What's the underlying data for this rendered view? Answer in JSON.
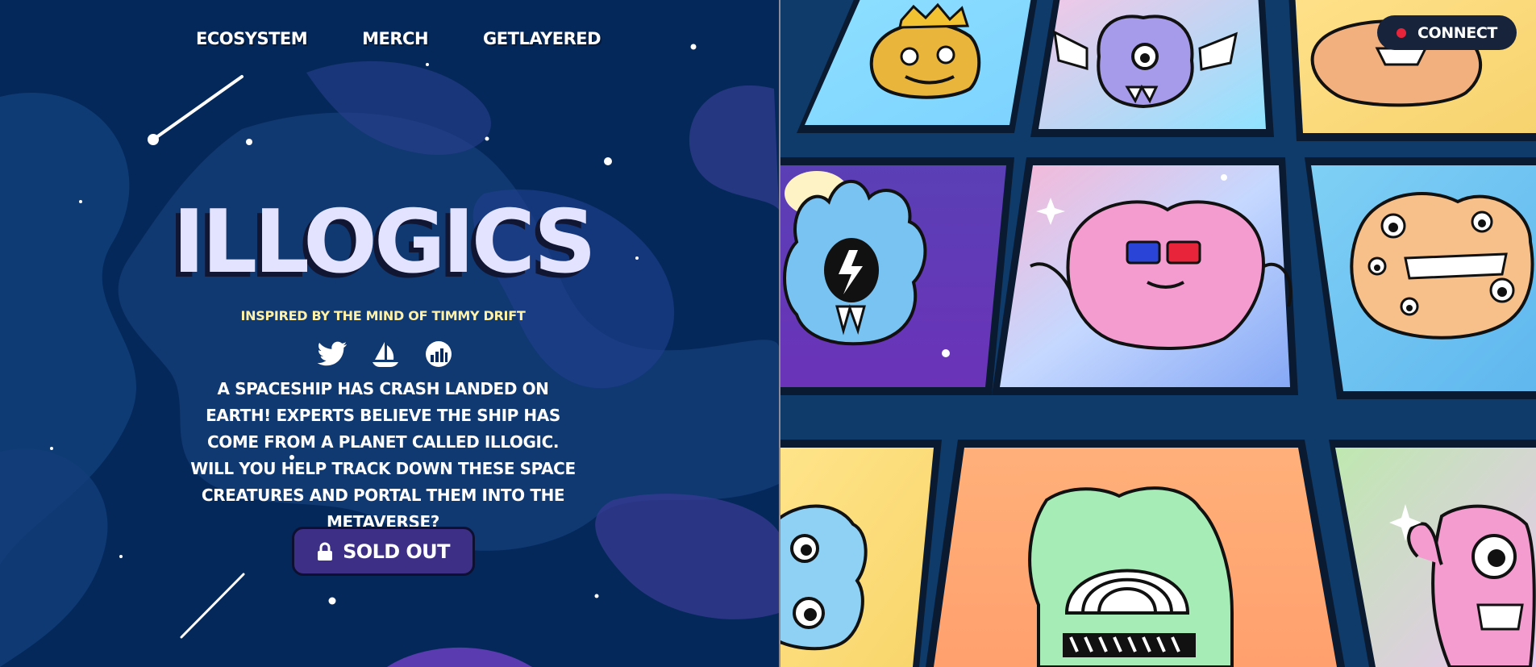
{
  "nav": {
    "items": [
      {
        "label": "ECOSYSTEM"
      },
      {
        "label": "MERCH"
      },
      {
        "label": "GETLAYERED"
      }
    ]
  },
  "hero": {
    "title": "ILLOGICS",
    "tagline": "INSPIRED BY THE MIND OF TIMMY DRIFT",
    "description": "A SPACESHIP HAS CRASH LANDED ON EARTH! EXPERTS BELIEVE THE SHIP HAS COME FROM A PLANET CALLED ILLOGIC. WILL YOU HELP TRACK DOWN THESE SPACE CREATURES AND PORTAL THEM INTO THE METAVERSE?",
    "button_label": "SOLD OUT"
  },
  "socials": [
    {
      "icon": "twitter-icon"
    },
    {
      "icon": "opensea-sailboat-icon"
    },
    {
      "icon": "rarity-chart-icon"
    }
  ],
  "header": {
    "connect_label": "CONNECT"
  },
  "colors": {
    "background": "#04285a",
    "title": "#e4e3ff",
    "tagline": "#fff2a8",
    "button": "#3e2f86",
    "connect_bg": "#17233b",
    "connect_dot": "#e8243a",
    "grid_bg": "#0f3b6b"
  },
  "gallery": {
    "cards": [
      {
        "creature": "crowned-yellow-blob"
      },
      {
        "creature": "winged-purple-fang-blob"
      },
      {
        "creature": "orange-tentacle-creature"
      },
      {
        "creature": "blue-flame-lightning-creature"
      },
      {
        "creature": "pink-creature-with-3d-glasses"
      },
      {
        "creature": "orange-many-eyed-blob"
      },
      {
        "creature": "blue-cloud-eyes-creature"
      },
      {
        "creature": "green-rainbow-mouth-creature"
      },
      {
        "creature": "pink-one-eyed-creature"
      }
    ]
  }
}
